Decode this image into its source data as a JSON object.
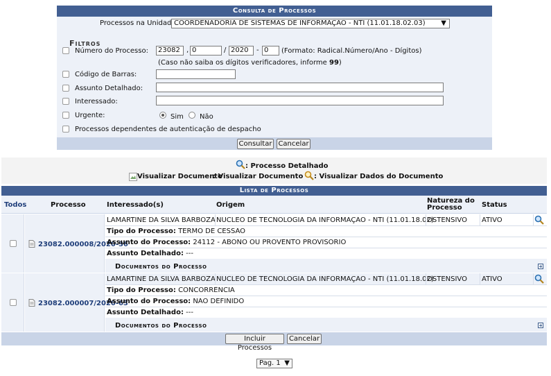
{
  "search": {
    "title": "Consulta de Processos",
    "unit_label": "Processos na Unidade:",
    "unit_value": "COORDENADORIA DE SISTEMAS DE INFORMAÇÃO - NTI (11.01.18.02.03)",
    "filters_title": "Filtros",
    "numero_label": "Número do Processo:",
    "numero_radical": "23082",
    "numero_num": "0",
    "numero_ano": "2020",
    "numero_dv": "0",
    "sep_comma": ",",
    "sep_slash": "/",
    "sep_dash": "-",
    "format_hint": "(Formato: Radical.Número/Ano - Dígitos)",
    "dv_hint_prefix": "(Caso não saiba os dígitos verificadores, informe",
    "dv_hint_value": "99",
    "dv_hint_suffix": ")",
    "barcode_label": "Código de Barras:",
    "assunto_label": "Assunto Detalhado:",
    "interessado_label": "Interessado:",
    "urgente_label": "Urgente:",
    "urgente_sim": "Sim",
    "urgente_nao": "Não",
    "dependentes_label": "Processos dependentes de autenticação de despacho",
    "consultar": "Consultar",
    "cancelar": "Cancelar"
  },
  "legend": {
    "detalhado": ": Processo Detalhado",
    "visualizar_doc_alt": "Visualizar Documento",
    "visualizar_doc": ": Visualizar Documento",
    "visualizar_dados": ": Visualizar Dados do Documento"
  },
  "list": {
    "title": "Lista de Processos",
    "columns": [
      "Todos",
      "Processo",
      "Interessado(s)",
      "Origem",
      "Natureza do Processo",
      "Status"
    ],
    "tipo_label": "Tipo do Processo:",
    "assunto_label": "Assunto do Processo:",
    "assunto_det_label": "Assunto Detalhado:",
    "docs_label": "Documentos do Processo",
    "rows": [
      {
        "processo": "23082.000008/2020-36",
        "interessado": "LAMARTINE DA SILVA BARBOZA",
        "origem": "NÚCLEO DE TECNOLOGIA DA INFORMAÇÃO - NTI (11.01.18.02)",
        "natureza": "OSTENSIVO",
        "status": "ATIVO",
        "tipo": "TERMO DE CESSÃO",
        "assunto": "24112 - ABONO OU PROVENTO PROVISÓRIO",
        "assunto_detalhado": "---"
      },
      {
        "processo": "23082.000007/2020-63",
        "interessado": "LAMARTINE DA SILVA BARBOZA",
        "origem": "NÚCLEO DE TECNOLOGIA DA INFORMAÇÃO - NTI (11.01.18.02)",
        "natureza": "OSTENSIVO",
        "status": "ATIVO",
        "tipo": "CONCORRÊNCIA",
        "assunto": "NÃO DEFINIDO",
        "assunto_detalhado": "---"
      }
    ],
    "incluir": "Incluir Processos",
    "cancelar": "Cancelar"
  },
  "pager": {
    "label": "Pag. 1"
  },
  "colors": {
    "header": "#425f92",
    "form_bg": "#edf1f8",
    "footer": "#c9d4e7",
    "row_bg": "#edf1f8"
  }
}
